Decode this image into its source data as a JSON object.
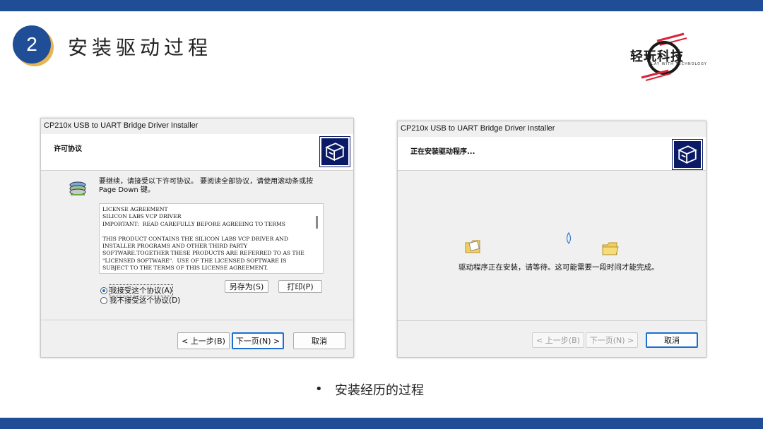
{
  "slide": {
    "step_number": "2",
    "title": "安装驱动过程",
    "logo_text": "轻玩科技",
    "logo_sub": "PLAY WITH TECHNOLOGY",
    "bullet": "安装经历的过程",
    "colors": {
      "bar": "#1f4e96",
      "accent": "#e6b450",
      "logo_red": "#d8263a"
    }
  },
  "license_window": {
    "title": "CP210x USB to UART Bridge Driver Installer",
    "header": "许可协议",
    "header_icon": "installer-box-icon",
    "instruction": "要继续，请接受以下许可协议。 要阅读全部协议，请使用滚动条或按 Page Down 键。",
    "instruction_icon": "install-disks-icon",
    "license_text": "LICENSE AGREEMENT\nSILICON LABS VCP DRIVER\nIMPORTANT:  READ CAREFULLY BEFORE AGREEING TO TERMS\n\nTHIS PRODUCT CONTAINS THE SILICON LABS VCP DRIVER AND\nINSTALLER PROGRAMS AND OTHER THIRD PARTY\nSOFTWARE.TOGETHER THESE PRODUCTS ARE REFERRED TO AS THE\n\"LICENSED SOFTWARE\".  USE OF THE LICENSED SOFTWARE IS\nSUBJECT TO THE TERMS OF THIS LICENSE AGREEMENT.",
    "radio_accept": "我接受这个协议(A)",
    "radio_decline": "我不接受这个协议(D)",
    "accept_selected": true,
    "save_as": "另存为(S)",
    "print": "打印(P)",
    "back": "< 上一步(B)",
    "next": "下一页(N) >",
    "cancel": "取消"
  },
  "install_window": {
    "title": "CP210x USB to UART Bridge Driver Installer",
    "header": "正在安装驱动程序...",
    "header_icon": "installer-box-icon",
    "animation_icons": [
      "folder-source-icon",
      "flying-document-icon",
      "folder-target-icon"
    ],
    "status": "驱动程序正在安装，请等待。这可能需要一段时间才能完成。",
    "back": "< 上一步(B)",
    "next": "下一页(N) >",
    "cancel": "取消"
  }
}
